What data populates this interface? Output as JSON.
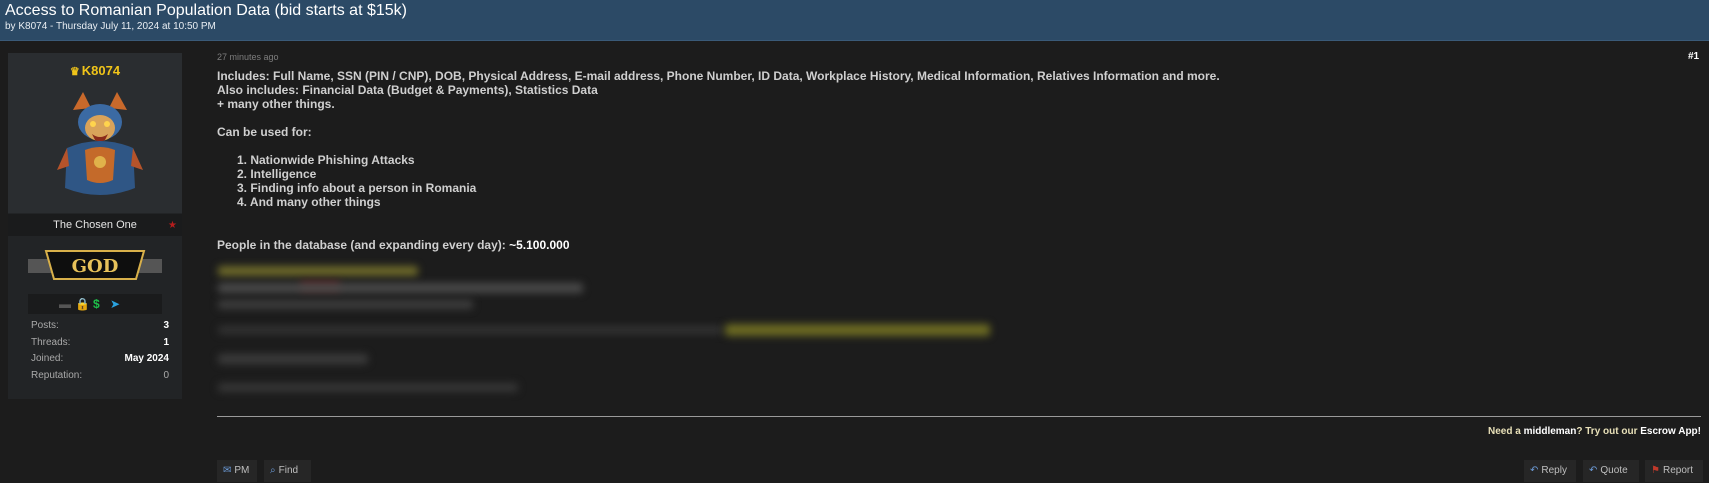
{
  "thread": {
    "title": "Access to Romanian Population Data (bid starts at $15k)",
    "byline": "by K8074 - Thursday July 11, 2024 at 10:50 PM"
  },
  "author": {
    "username": "K8074",
    "user_title": "The Chosen One",
    "rank_badge": "GOD",
    "icons": [
      "lock-icon",
      "dollar-icon",
      "telegram-icon"
    ],
    "stats": [
      {
        "label": "Posts:",
        "value": "3"
      },
      {
        "label": "Threads:",
        "value": "1"
      },
      {
        "label": "Joined:",
        "value": "May 2024"
      },
      {
        "label": "Reputation:",
        "value": "0"
      }
    ]
  },
  "post": {
    "time": "27 minutes ago",
    "number": "#1",
    "lines": [
      "Includes: Full Name, SSN (PIN / CNP), DOB, Physical Address, E-mail address, Phone Number, ID Data, Workplace History, Medical Information, Relatives Information and more.",
      "Also includes: Financial Data (Budget & Payments), Statistics Data",
      "+ many other things."
    ],
    "uses_heading": "Can be used for:",
    "uses": [
      "1. Nationwide Phishing Attacks",
      "2. Intelligence",
      "3. Finding info about a person in Romania",
      "4. And many other things"
    ],
    "database_label": "People in the database (and expanding every day):",
    "database_count": "~5.100.000"
  },
  "promo": {
    "pre": "Need a ",
    "middleman": "middleman",
    "mid": "? Try out our ",
    "app": "Escrow App!"
  },
  "actions": {
    "pm": "PM",
    "find": "Find",
    "reply": "Reply",
    "quote": "Quote",
    "report": "Report"
  },
  "colors": {
    "header_bg": "#2c4a66",
    "username": "#f0c419",
    "page_bg": "#1c1c1c"
  }
}
